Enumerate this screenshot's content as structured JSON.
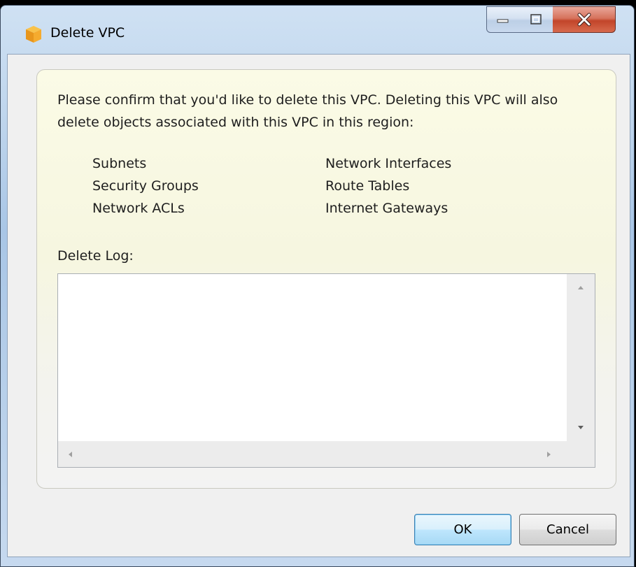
{
  "window": {
    "title": "Delete VPC",
    "icon": "aws-cube-icon",
    "controls": {
      "minimize": "minimize-icon",
      "maximize": "maximize-icon",
      "close": "close-icon"
    }
  },
  "dialog": {
    "message": "Please confirm that you'd like to delete this VPC. Deleting this VPC will also delete objects associated with this VPC in this region:",
    "objects_column_1": [
      "Subnets",
      "Security Groups",
      "Network ACLs"
    ],
    "objects_column_2": [
      "Network Interfaces",
      "Route Tables",
      "Internet Gateways"
    ],
    "log_label": "Delete Log:",
    "log_value": ""
  },
  "buttons": {
    "ok_label": "OK",
    "cancel_label": "Cancel"
  },
  "colors": {
    "close_button": "#c2452a",
    "ok_button_border": "#3c7fb1",
    "panel_background": "#fbfbe6"
  }
}
